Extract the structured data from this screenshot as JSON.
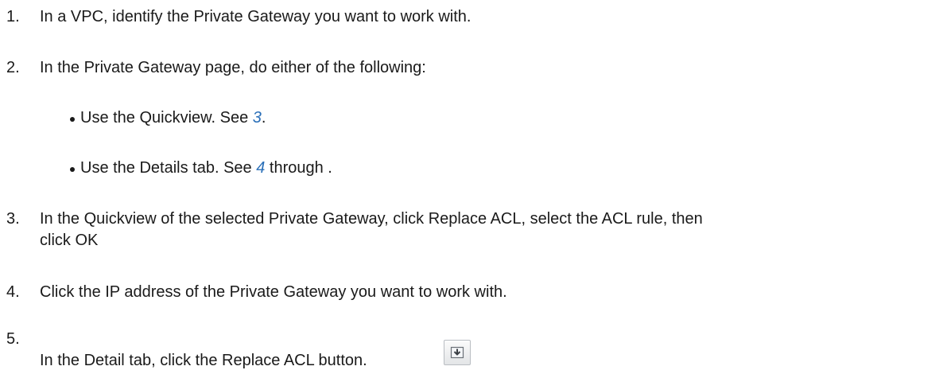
{
  "steps": [
    {
      "num": "1.",
      "text": "In a VPC, identify the Private Gateway you want to work with."
    },
    {
      "num": "2.",
      "text": "In the Private Gateway page, do either of the following:"
    },
    {
      "num": "3.",
      "text_line1": "In the Quickview of the selected Private Gateway, click Replace ACL, select the ACL rule, then",
      "text_line2": "click OK"
    },
    {
      "num": "4.",
      "text": "Click the IP address of the Private Gateway you want to work with."
    },
    {
      "num": "5.",
      "text": "In the Detail tab, click the Replace ACL button."
    }
  ],
  "bullets": [
    {
      "prefix": "Use the Quickview. See ",
      "link": "3",
      "suffix": "."
    },
    {
      "prefix": "Use the Details tab. See ",
      "link": "4",
      "suffix": " through ."
    }
  ],
  "icons": {
    "replace_acl": "replace-acl-icon"
  }
}
